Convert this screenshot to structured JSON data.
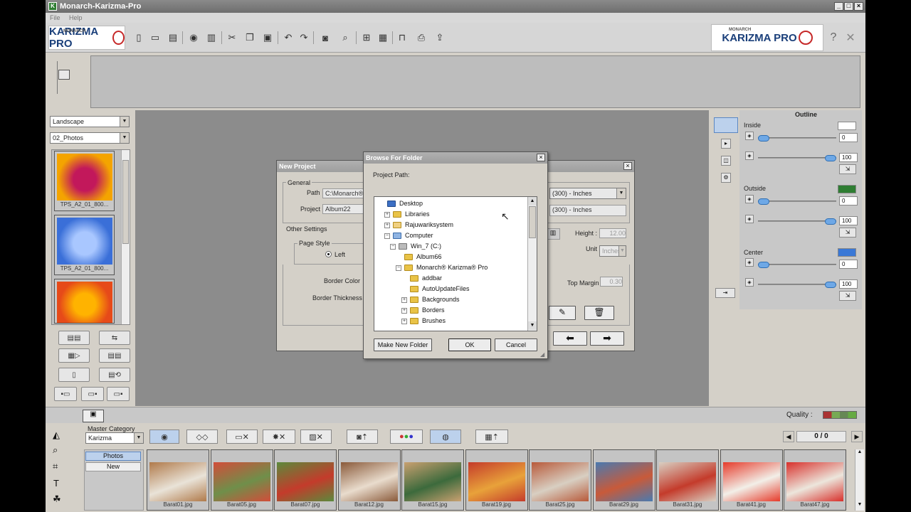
{
  "window": {
    "title": "Monarch-Karizma-Pro"
  },
  "menu": [
    "File",
    "Help"
  ],
  "logo": {
    "brand": "KARIZMA PRO",
    "super": "MONARCH"
  },
  "left_panel": {
    "orientation": "Landscape",
    "category": "02_Photos",
    "templates": [
      {
        "caption": "TPS_A2_01_800...",
        "colors": [
          "#f4a400",
          "#c2185b"
        ]
      },
      {
        "caption": "TPS_A2_01_800...",
        "colors": [
          "#3a6fd8",
          "#a9c7ff"
        ]
      },
      {
        "caption": "",
        "colors": [
          "#e64a19",
          "#ffb300"
        ]
      }
    ]
  },
  "new_project": {
    "title": "New Project",
    "general_legend": "General",
    "path_label": "Path",
    "path_value": "C:\\Monarch®",
    "project_label": "Project",
    "project_value": "Album22",
    "size_value_1": "(300) - Inches",
    "size_value_2": "(300) - Inches",
    "other_legend": "Other Settings",
    "page_style_legend": "Page Style",
    "page_style_option": "Left",
    "height_label": "Height :",
    "height_value": "12.00",
    "unit_label": "Unit",
    "unit_value": "Inches",
    "border_color_label": "Border Color",
    "border_thickness_label": "Border Thickness",
    "top_margin_label": "Top Margin",
    "top_margin_value": "0.30"
  },
  "browse": {
    "title": "Browse For Folder",
    "project_path_label": "Project Path:",
    "tree": [
      {
        "label": "Desktop",
        "indent": 0,
        "expander": "",
        "kind": "desktop"
      },
      {
        "label": "Libraries",
        "indent": 1,
        "expander": "+",
        "kind": "folder"
      },
      {
        "label": "Rajuwariksystem",
        "indent": 1,
        "expander": "+",
        "kind": "user"
      },
      {
        "label": "Computer",
        "indent": 1,
        "expander": "−",
        "kind": "computer"
      },
      {
        "label": "Win_7 (C:)",
        "indent": 2,
        "expander": "−",
        "kind": "drive"
      },
      {
        "label": "Album66",
        "indent": 3,
        "expander": "",
        "kind": "folder"
      },
      {
        "label": "Monarch® Karizma® Pro",
        "indent": 3,
        "expander": "−",
        "kind": "folder"
      },
      {
        "label": "addbar",
        "indent": 4,
        "expander": "",
        "kind": "folder"
      },
      {
        "label": "AutoUpdateFiles",
        "indent": 4,
        "expander": "",
        "kind": "folder"
      },
      {
        "label": "Backgrounds",
        "indent": 4,
        "expander": "+",
        "kind": "folder"
      },
      {
        "label": "Borders",
        "indent": 4,
        "expander": "+",
        "kind": "folder"
      },
      {
        "label": "Brushes",
        "indent": 4,
        "expander": "+",
        "kind": "folder"
      }
    ],
    "make_new_folder": "Make New Folder",
    "ok": "OK",
    "cancel": "Cancel"
  },
  "outline": {
    "title": "Outline",
    "inside": {
      "label": "Inside",
      "color": "#ffffff",
      "value1": "0",
      "value2": "100"
    },
    "outside": {
      "label": "Outside",
      "color": "#2e7d32",
      "value1": "0",
      "value2": "100"
    },
    "center": {
      "label": "Center",
      "color": "#3a78d6",
      "value1": "0",
      "value2": "100"
    }
  },
  "quality": {
    "label": "Quality :"
  },
  "bottom": {
    "master_category_label": "Master Category",
    "master_category_value": "Karizma",
    "tabs": [
      "Photos",
      "New"
    ],
    "counter": "0 / 0",
    "photos": [
      {
        "caption": "Barat01.jpg",
        "colors": [
          "#b07a4a",
          "#e9e3d8"
        ]
      },
      {
        "caption": "Barat05.jpg",
        "colors": [
          "#d24d3a",
          "#6f8f4a"
        ]
      },
      {
        "caption": "Barat07.jpg",
        "colors": [
          "#5b8a3c",
          "#c43b2b"
        ]
      },
      {
        "caption": "Barat12.jpg",
        "colors": [
          "#8a5a3a",
          "#e9dccd"
        ]
      },
      {
        "caption": "Barat15.jpg",
        "colors": [
          "#c9a070",
          "#3c6a3c"
        ]
      },
      {
        "caption": "Barat19.jpg",
        "colors": [
          "#c43b2b",
          "#e8a23a"
        ]
      },
      {
        "caption": "Barat25.jpg",
        "colors": [
          "#b85a3a",
          "#d8cfc2"
        ]
      },
      {
        "caption": "Barat29.jpg",
        "colors": [
          "#4a7ab0",
          "#c85a3a"
        ]
      },
      {
        "caption": "Barat31.jpg",
        "colors": [
          "#d8cfc2",
          "#c43b2b"
        ]
      },
      {
        "caption": "Barat41.jpg",
        "colors": [
          "#e63b2b",
          "#f2efe8"
        ]
      },
      {
        "caption": "Barat47.jpg",
        "colors": [
          "#d8302b",
          "#ece6dc"
        ]
      }
    ]
  }
}
